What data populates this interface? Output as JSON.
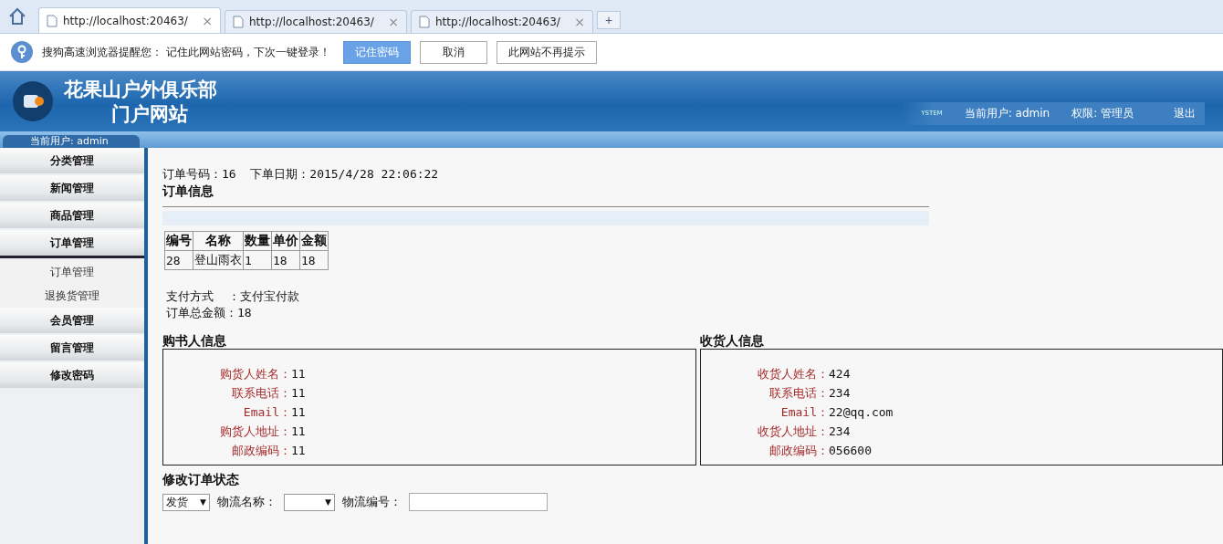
{
  "browser": {
    "tabs": [
      {
        "label": "http://localhost:20463/",
        "selected": true
      },
      {
        "label": "http://localhost:20463/",
        "selected": false
      },
      {
        "label": "http://localhost:20463/",
        "selected": false
      }
    ],
    "close_glyph": "×",
    "new_tab_glyph": "+"
  },
  "notice": {
    "message": "搜狗高速浏览器提醒您： 记住此网站密码，下次一键登录！",
    "buttons": [
      {
        "label": "记住密码",
        "primary": true
      },
      {
        "label": "取消",
        "primary": false
      },
      {
        "label": "此网站不再提示",
        "primary": false
      }
    ]
  },
  "header": {
    "title": "花果山户外俱乐部",
    "subtitle": "门户网站",
    "system_mark": "YSTEM",
    "current_user": "当前用户: admin",
    "role": "权限: 管理员",
    "logout": "退出"
  },
  "sidebar": {
    "user": "当前用户: admin",
    "items": [
      {
        "label": "分类管理",
        "expanded": false
      },
      {
        "label": "新闻管理",
        "expanded": false
      },
      {
        "label": "商品管理",
        "expanded": false
      },
      {
        "label": "订单管理",
        "expanded": true,
        "children": [
          {
            "label": "订单管理"
          },
          {
            "label": "退换货管理"
          }
        ]
      },
      {
        "label": "会员管理",
        "expanded": false
      },
      {
        "label": "留言管理",
        "expanded": false
      },
      {
        "label": "修改密码",
        "expanded": false
      }
    ]
  },
  "order": {
    "number_line": "订单号码：16  下单日期：2015/4/28 22:06:22",
    "section_title": "订单信息",
    "table": {
      "columns": [
        "编号",
        "名称",
        "数量",
        "单价",
        "金额"
      ],
      "rows": [
        [
          "28",
          "登山雨衣",
          "1",
          "18",
          "18"
        ]
      ]
    },
    "payment": "支付方式  ：支付宝付款",
    "total": "订单总金额：18"
  },
  "buyer": {
    "title": "购书人信息",
    "fields": [
      {
        "label": "购货人姓名：",
        "value": "11"
      },
      {
        "label": "联系电话：",
        "value": "11"
      },
      {
        "label": "Email：",
        "value": "11"
      },
      {
        "label": "购货人地址：",
        "value": "11"
      },
      {
        "label": "邮政编码：",
        "value": "11"
      }
    ]
  },
  "receiver": {
    "title": "收货人信息",
    "fields": [
      {
        "label": "收货人姓名：",
        "value": "424"
      },
      {
        "label": "联系电话：",
        "value": "234"
      },
      {
        "label": "Email：",
        "value": "22@qq.com"
      },
      {
        "label": "收货人地址：",
        "value": "234"
      },
      {
        "label": "邮政编码：",
        "value": "056600"
      }
    ]
  },
  "status": {
    "title": "修改订单状态",
    "state_value": "发货",
    "dropdown_glyph": "▼",
    "carrier_label": "物流名称：",
    "tracking_label": "物流编号："
  }
}
